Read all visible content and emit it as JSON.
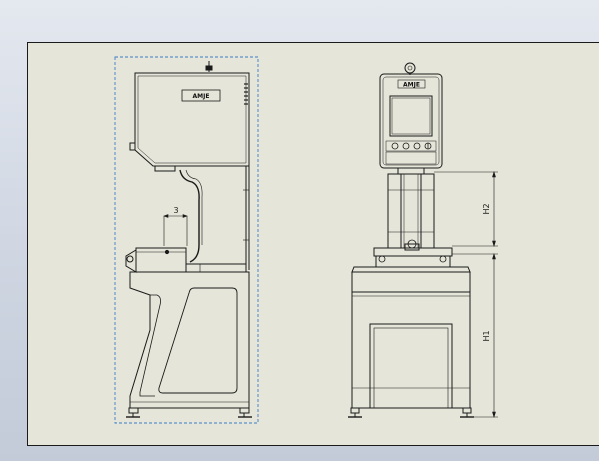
{
  "drawing": {
    "side_view": {
      "badge": "AMJE",
      "dimension_label": "3"
    },
    "front_view": {
      "badge": "AMJE",
      "dimension_h1": "H1",
      "dimension_h2": "H2"
    },
    "colors": {
      "sheet": "#e6e5d9",
      "line": "#1a1a1a",
      "selection": "#3a7cc8"
    }
  }
}
